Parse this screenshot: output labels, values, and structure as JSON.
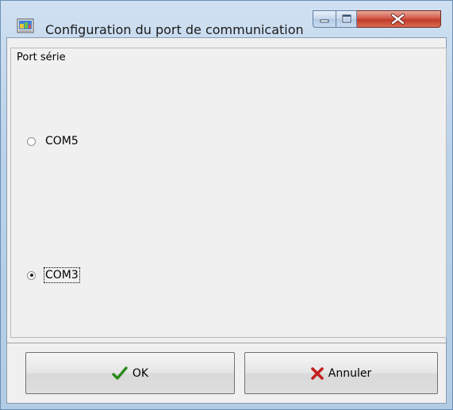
{
  "window": {
    "title": "Configuration du port de communication",
    "icon": "app-icon"
  },
  "group": {
    "title": "Port série",
    "options": [
      {
        "label": "COM5",
        "selected": false
      },
      {
        "label": "COM3",
        "selected": true
      }
    ]
  },
  "buttons": {
    "ok_label": "OK",
    "ok_icon": "checkmark-icon",
    "cancel_label": "Annuler",
    "cancel_icon": "cross-icon"
  },
  "colors": {
    "ok_icon": "#2a8a1a",
    "cancel_icon": "#c41e1e",
    "close_button": "#c8412e"
  }
}
